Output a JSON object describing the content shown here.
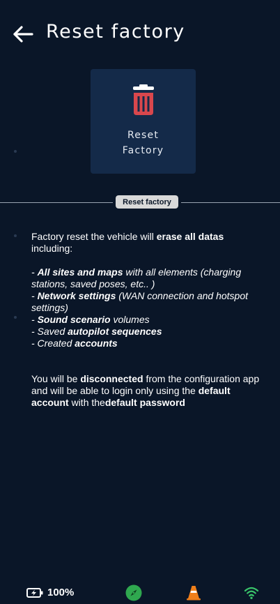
{
  "header": {
    "title": "Reset factory"
  },
  "tile": {
    "label_line1": "Reset",
    "label_line2": "Factory"
  },
  "section": {
    "chip_label": "Reset factory"
  },
  "content": {
    "intro_a": "Factory reset the vehicle will ",
    "intro_b": "erase all datas",
    "intro_c": " including:",
    "item1_dash": "- ",
    "item1_bold": "All sites and maps",
    "item1_rest": " with all elements (charging stations, saved poses, etc.. )",
    "item2_dash": "- ",
    "item2_bold": "Network settings",
    "item2_rest": " (WAN connection and hotspot settings)",
    "item3_dash": "- ",
    "item3_bold": "Sound scenario",
    "item3_rest": " volumes",
    "item4_pre": "- Saved ",
    "item4_bold": "autopilot sequences",
    "item5_pre": "- Created ",
    "item5_bold": "accounts",
    "outro_a": "You will be ",
    "outro_b": "disconnected",
    "outro_c": " from the configuration app and will be able to login only using the ",
    "outro_d": "default account",
    "outro_e": " with the",
    "outro_f": "default password"
  },
  "status": {
    "battery": "100%"
  },
  "colors": {
    "background": "#0a1628",
    "tile": "#142a49",
    "danger": "#d9474d",
    "compass": "#2fa84f",
    "cone": "#f07f1a",
    "wifi": "#39c46a"
  }
}
